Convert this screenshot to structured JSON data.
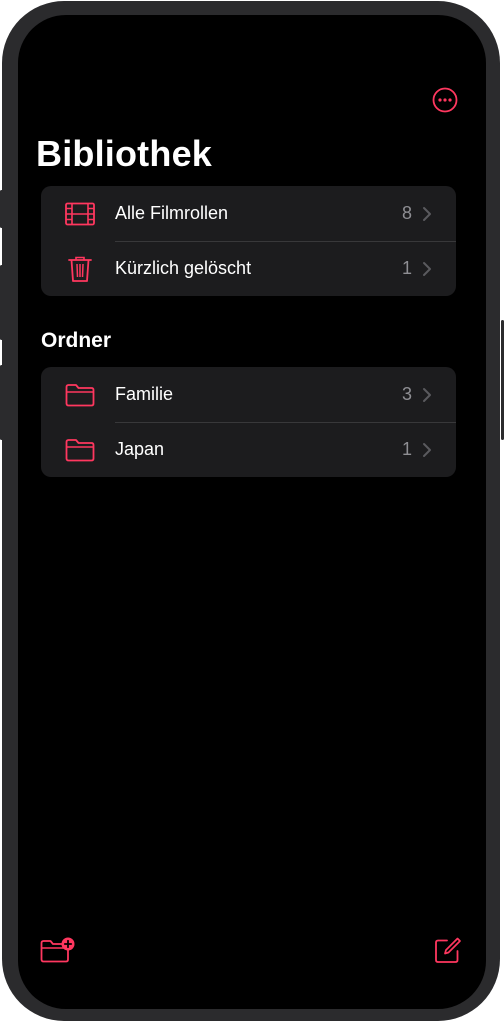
{
  "colors": {
    "accent": "#ff375f",
    "background": "#000000",
    "group_background": "#1c1c1e",
    "separator": "#38383a",
    "text_primary": "#ffffff",
    "text_secondary": "#8e8e93",
    "frame": "#2b2b2d"
  },
  "header": {
    "more_icon": "ellipsis-circle-icon",
    "title": "Bibliothek"
  },
  "library": {
    "items": [
      {
        "label": "Alle Filmrollen",
        "count": "8",
        "icon": "film-icon"
      },
      {
        "label": "Kürzlich gelöscht",
        "count": "1",
        "icon": "trash-icon"
      }
    ]
  },
  "folders": {
    "title": "Ordner",
    "items": [
      {
        "label": "Familie",
        "count": "3",
        "icon": "folder-icon"
      },
      {
        "label": "Japan",
        "count": "1",
        "icon": "folder-icon"
      }
    ]
  },
  "toolbar": {
    "new_folder_icon": "folder-badge-plus-icon",
    "compose_icon": "compose-icon"
  }
}
